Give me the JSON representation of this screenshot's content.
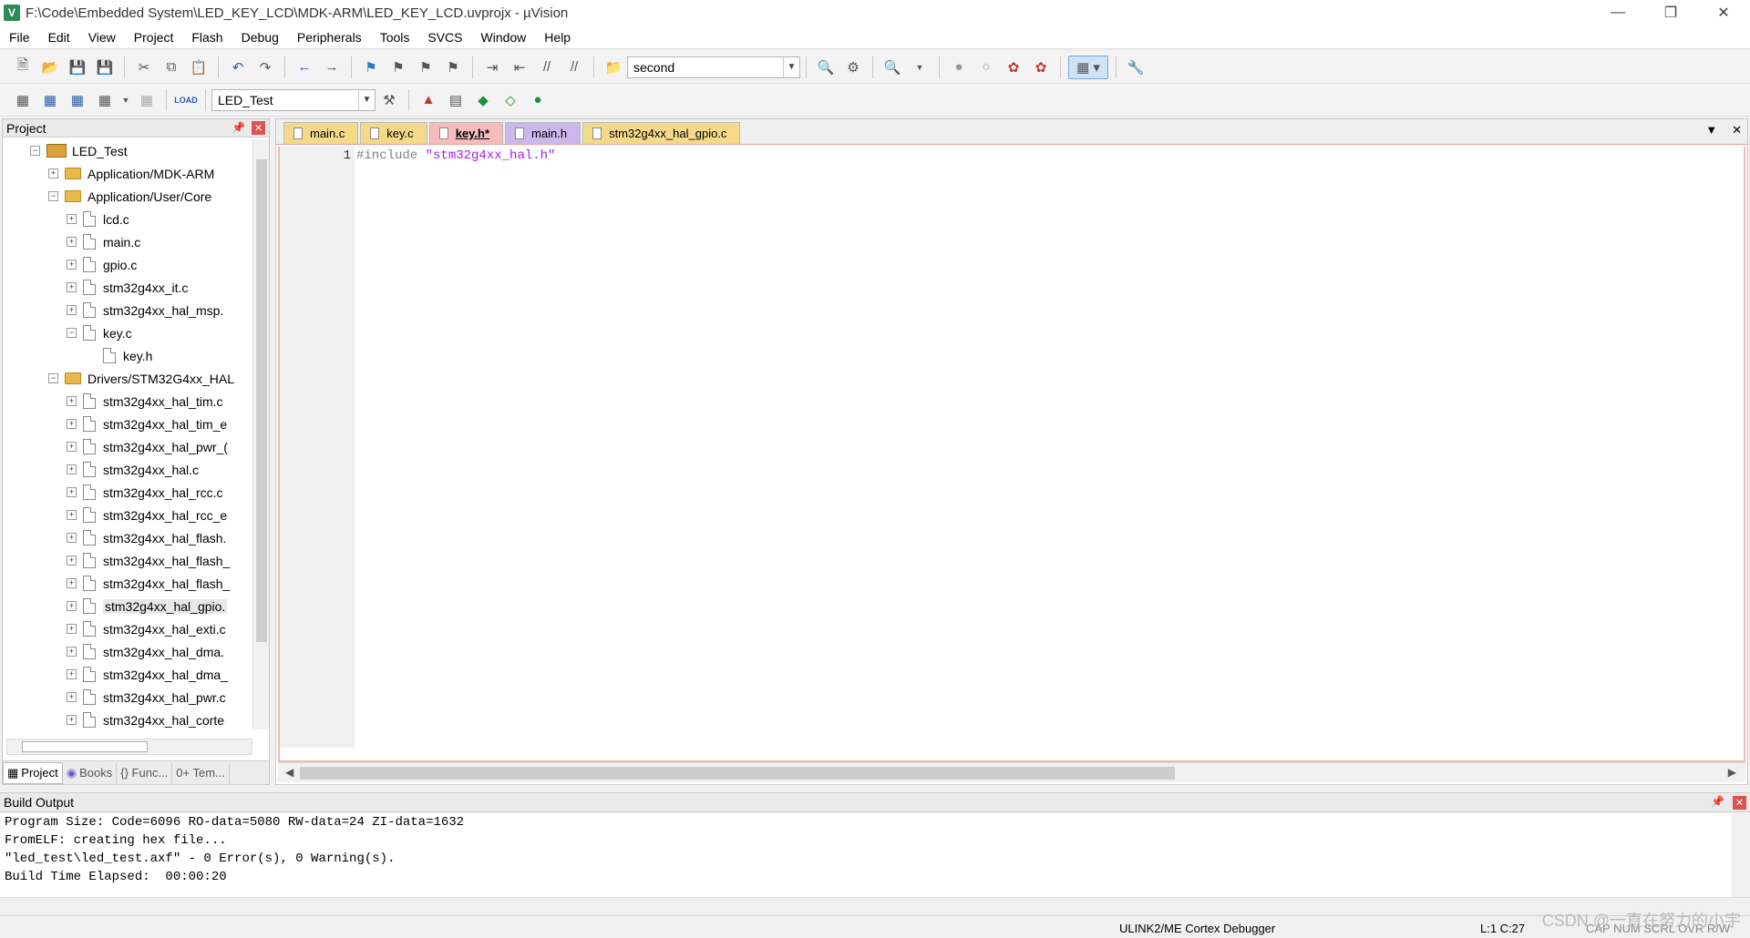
{
  "window": {
    "title": "F:\\Code\\Embedded System\\LED_KEY_LCD\\MDK-ARM\\LED_KEY_LCD.uvprojx - µVision",
    "app_icon_text": "V"
  },
  "menu": [
    "File",
    "Edit",
    "View",
    "Project",
    "Flash",
    "Debug",
    "Peripherals",
    "Tools",
    "SVCS",
    "Window",
    "Help"
  ],
  "toolbar1": {
    "find_combo_value": "second"
  },
  "toolbar2": {
    "target_combo_value": "LED_Test",
    "load_label": "LOAD"
  },
  "project_panel": {
    "title": "Project",
    "tree": [
      {
        "label": "LED_Test",
        "depth": 0,
        "type": "root",
        "exp": "−"
      },
      {
        "label": "Application/MDK-ARM",
        "depth": 1,
        "type": "folder",
        "exp": "+"
      },
      {
        "label": "Application/User/Core",
        "depth": 1,
        "type": "folder",
        "exp": "−"
      },
      {
        "label": "lcd.c",
        "depth": 2,
        "type": "file",
        "exp": "+"
      },
      {
        "label": "main.c",
        "depth": 2,
        "type": "file",
        "exp": "+"
      },
      {
        "label": "gpio.c",
        "depth": 2,
        "type": "file",
        "exp": "+"
      },
      {
        "label": "stm32g4xx_it.c",
        "depth": 2,
        "type": "file",
        "exp": "+"
      },
      {
        "label": "stm32g4xx_hal_msp.",
        "depth": 2,
        "type": "file",
        "exp": "+"
      },
      {
        "label": "key.c",
        "depth": 2,
        "type": "file",
        "exp": "−"
      },
      {
        "label": "key.h",
        "depth": 3,
        "type": "file",
        "exp": ""
      },
      {
        "label": "Drivers/STM32G4xx_HAL",
        "depth": 1,
        "type": "folder",
        "exp": "−"
      },
      {
        "label": "stm32g4xx_hal_tim.c",
        "depth": 2,
        "type": "file",
        "exp": "+"
      },
      {
        "label": "stm32g4xx_hal_tim_e",
        "depth": 2,
        "type": "file",
        "exp": "+"
      },
      {
        "label": "stm32g4xx_hal_pwr_(",
        "depth": 2,
        "type": "file",
        "exp": "+"
      },
      {
        "label": "stm32g4xx_hal.c",
        "depth": 2,
        "type": "file",
        "exp": "+"
      },
      {
        "label": "stm32g4xx_hal_rcc.c",
        "depth": 2,
        "type": "file",
        "exp": "+"
      },
      {
        "label": "stm32g4xx_hal_rcc_e",
        "depth": 2,
        "type": "file",
        "exp": "+"
      },
      {
        "label": "stm32g4xx_hal_flash.",
        "depth": 2,
        "type": "file",
        "exp": "+"
      },
      {
        "label": "stm32g4xx_hal_flash_",
        "depth": 2,
        "type": "file",
        "exp": "+"
      },
      {
        "label": "stm32g4xx_hal_flash_",
        "depth": 2,
        "type": "file",
        "exp": "+"
      },
      {
        "label": "stm32g4xx_hal_gpio.",
        "depth": 2,
        "type": "file",
        "exp": "+",
        "selected": true
      },
      {
        "label": "stm32g4xx_hal_exti.c",
        "depth": 2,
        "type": "file",
        "exp": "+"
      },
      {
        "label": "stm32g4xx_hal_dma.",
        "depth": 2,
        "type": "file",
        "exp": "+"
      },
      {
        "label": "stm32g4xx_hal_dma_",
        "depth": 2,
        "type": "file",
        "exp": "+"
      },
      {
        "label": "stm32g4xx_hal_pwr.c",
        "depth": 2,
        "type": "file",
        "exp": "+"
      },
      {
        "label": "stm32g4xx_hal_corte",
        "depth": 2,
        "type": "file",
        "exp": "+"
      }
    ],
    "bottom_tabs": [
      "Project",
      "Books",
      "{} Func...",
      "0+ Tem..."
    ]
  },
  "editor": {
    "tabs": [
      {
        "label": "main.c",
        "kind": "c"
      },
      {
        "label": "key.c",
        "kind": "c"
      },
      {
        "label": "key.h*",
        "kind": "active"
      },
      {
        "label": "main.h",
        "kind": "h"
      },
      {
        "label": "stm32g4xx_hal_gpio.c",
        "kind": "c"
      }
    ],
    "line_number": "1",
    "code_directive": "#include",
    "code_string": "\"stm32g4xx_hal.h\""
  },
  "build_output": {
    "title": "Build Output",
    "lines": [
      "Program Size: Code=6096 RO-data=5080 RW-data=24 ZI-data=1632",
      "FromELF: creating hex file...",
      "\"led_test\\led_test.axf\" - 0 Error(s), 0 Warning(s).",
      "Build Time Elapsed:  00:00:20"
    ]
  },
  "statusbar": {
    "debugger": "ULINK2/ME Cortex Debugger",
    "position": "L:1 C:27",
    "flags": "CAP NUM SCRL OVR R/W"
  },
  "watermark": "CSDN @一直在努力的小宇"
}
